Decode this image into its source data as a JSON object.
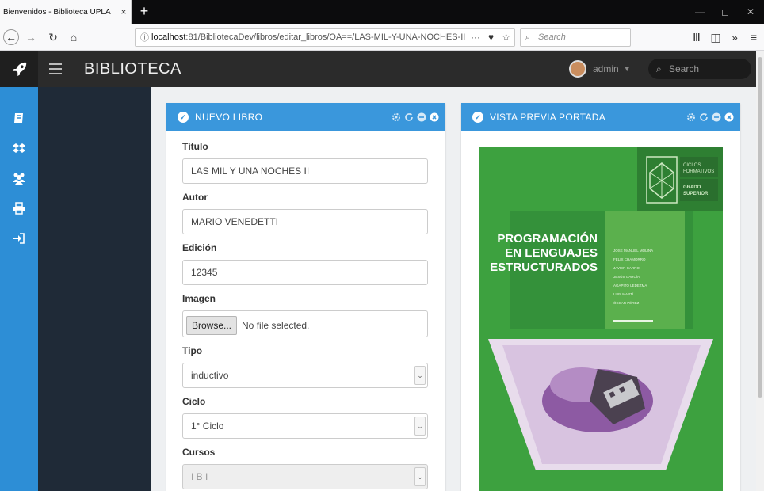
{
  "browser": {
    "tab_title": "Bienvenidos - Biblioteca UPLA",
    "tab_close": "×",
    "new_tab": "+",
    "url_host": "localhost",
    "url_rest": ":81/BibliotecaDev/libros/editar_libros/OA==/LAS-MIL-Y-UNA-NOCHES-II",
    "search_placeholder": "Search"
  },
  "app": {
    "title": "BIBLIOTECA",
    "user": "admin",
    "search_placeholder": "Search"
  },
  "form_panel": {
    "title": "NUEVO LIBRO",
    "fields": {
      "titulo_label": "Título",
      "titulo_value": "LAS MIL Y UNA NOCHES II",
      "autor_label": "Autor",
      "autor_value": "MARIO VENEDETTI",
      "edicion_label": "Edición",
      "edicion_value": "12345",
      "imagen_label": "Imagen",
      "browse_label": "Browse...",
      "file_status": "No file selected.",
      "tipo_label": "Tipo",
      "tipo_value": "inductivo",
      "ciclo_label": "Ciclo",
      "ciclo_value": "1° Ciclo",
      "cursos_label": "Cursos",
      "cursos_value": "I B I"
    }
  },
  "preview_panel": {
    "title": "VISTA PREVIA PORTADA",
    "cover": {
      "series_line1": "CICLOS",
      "series_line2": "FORMATIVOS",
      "grade_line1": "GRADO",
      "grade_line2": "SUPERIOR",
      "title_line1": "PROGRAMACIÓN",
      "title_line2": "EN LENGUAJES",
      "title_line3": "ESTRUCTURADOS",
      "authors": [
        "JOSÉ MANUEL MOLINA",
        "FÉLIX CHAMORRO",
        "JAVIER CARRO",
        "JESÚS GARCÍA",
        "AGAPITO LEDEZMA",
        "LUIS MARTÍ",
        "ÓSCAR PÉREZ"
      ]
    }
  },
  "colors": {
    "accent": "#3a97dc",
    "rail": "#2d8ed6",
    "cover_green": "#3da13f",
    "header": "#2b2b2b"
  }
}
